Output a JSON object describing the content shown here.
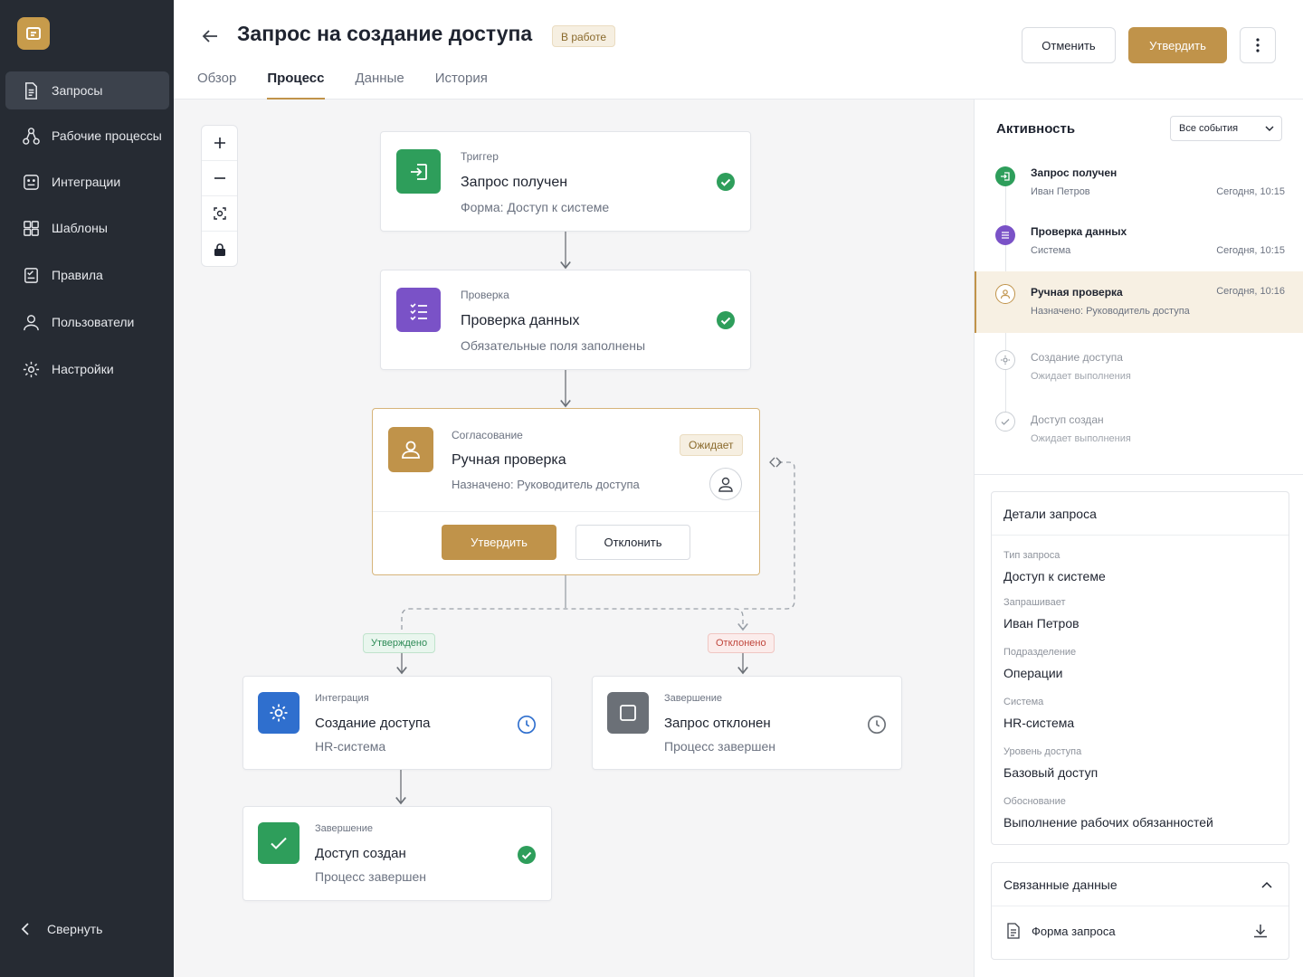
{
  "sidebar": {
    "items": [
      {
        "label": "Запросы",
        "icon": "document-icon"
      },
      {
        "label": "Рабочие процессы",
        "icon": "workflow-icon"
      },
      {
        "label": "Интеграции",
        "icon": "integration-icon"
      },
      {
        "label": "Шаблоны",
        "icon": "templates-icon"
      },
      {
        "label": "Правила",
        "icon": "rules-icon"
      },
      {
        "label": "Пользователи",
        "icon": "user-icon"
      },
      {
        "label": "Настройки",
        "icon": "gear-icon"
      }
    ],
    "collapse_label": "Свернуть"
  },
  "header": {
    "title": "Запрос на создание доступа",
    "status_badge": "В работе",
    "cancel_label": "Отменить",
    "approve_label": "Утвердить",
    "tabs": [
      {
        "label": "Обзор"
      },
      {
        "label": "Процесс"
      },
      {
        "label": "Данные"
      },
      {
        "label": "История"
      }
    ]
  },
  "flow": {
    "trigger": {
      "category": "Триггер",
      "name": "Запрос получен",
      "sub": "Форма: Доступ к системе"
    },
    "check": {
      "category": "Проверка",
      "name": "Проверка данных",
      "sub": "Обязательные поля заполнены"
    },
    "approval": {
      "category": "Согласование",
      "name": "Ручная проверка",
      "sub": "Назначено: Руководитель доступа",
      "badge": "Ожидает",
      "approve_label": "Утвердить",
      "reject_label": "Отклонить"
    },
    "branch_approved": "Утверждено",
    "branch_rejected": "Отклонено",
    "integration": {
      "category": "Интеграция",
      "name": "Создание доступа",
      "sub": "HR-система"
    },
    "rejected_end": {
      "category": "Завершение",
      "name": "Запрос отклонен",
      "sub": "Процесс завершен"
    },
    "success_end": {
      "category": "Завершение",
      "name": "Доступ создан",
      "sub": "Процесс завершен"
    }
  },
  "activity": {
    "title": "Активность",
    "filter": "Все события",
    "events": [
      {
        "title": "Запрос получен",
        "sub": "Иван Петров",
        "time": "Сегодня, 10:15"
      },
      {
        "title": "Проверка данных",
        "sub": "Система",
        "time": "Сегодня, 10:15"
      },
      {
        "title": "Ручная проверка",
        "sub": "Назначено: Руководитель доступа",
        "time": "Сегодня, 10:16"
      },
      {
        "title": "Создание доступа",
        "sub": "Ожидает выполнения"
      },
      {
        "title": "Доступ создан",
        "sub": "Ожидает выполнения"
      }
    ]
  },
  "details": {
    "title": "Детали запроса",
    "fields": [
      {
        "label": "Тип запроса",
        "value": "Доступ к системе"
      },
      {
        "label": "Запрашивает",
        "value": "Иван Петров"
      },
      {
        "label": "Подразделение",
        "value": "Операции"
      },
      {
        "label": "Система",
        "value": "HR-система"
      },
      {
        "label": "Уровень доступа",
        "value": "Базовый доступ"
      },
      {
        "label": "Обоснование",
        "value": "Выполнение рабочих обязанностей"
      }
    ]
  },
  "related": {
    "title": "Связанные данные",
    "file": "Форма запроса"
  },
  "colors": {
    "accent": "#c0934a",
    "sidebar_bg": "#262b33",
    "success": "#2e9e5b",
    "purple": "#7a52c7",
    "blue": "#2f6fce",
    "gray": "#6b7077"
  }
}
